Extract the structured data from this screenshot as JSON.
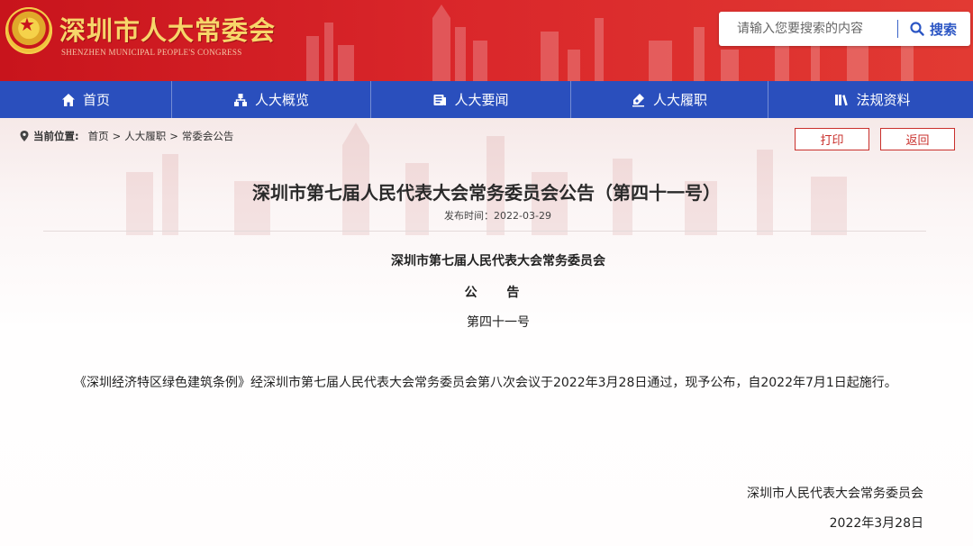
{
  "header": {
    "site_title": "深圳市人大常委会",
    "site_subtitle": "SHENZHEN MUNICIPAL PEOPLE'S CONGRESS"
  },
  "search": {
    "placeholder": "请输入您要搜索的内容",
    "button_label": "搜索"
  },
  "nav": {
    "items": [
      {
        "label": "首页",
        "icon": "home-icon"
      },
      {
        "label": "人大概览",
        "icon": "sitemap-icon"
      },
      {
        "label": "人大要闻",
        "icon": "news-icon"
      },
      {
        "label": "人大履职",
        "icon": "duty-icon"
      },
      {
        "label": "法规资料",
        "icon": "books-icon"
      }
    ]
  },
  "breadcrumb": {
    "label": "当前位置:",
    "items": [
      "首页",
      "人大履职",
      "常委会公告"
    ],
    "separator": ">"
  },
  "toolbar": {
    "print_label": "打印",
    "back_label": "返回"
  },
  "article": {
    "title": "深圳市第七届人民代表大会常务委员会公告（第四十一号）",
    "date": "发布时间：2022-03-29",
    "issuer": "深圳市第七届人民代表大会常务委员会",
    "doc_type": "公 告",
    "number": "第四十一号",
    "body": "《深圳经济特区绿色建筑条例》经深圳市第七届人民代表大会常务委员会第八次会议于2022年3月28日通过，现予公布，自2022年7月1日起施行。",
    "signature": "深圳市人民代表大会常务委员会",
    "sign_date": "2022年3月28日"
  },
  "colors": {
    "header_red": "#d9262a",
    "nav_blue": "#2a4fbd",
    "title_gold": "#f7d66a",
    "button_red": "#c9302c",
    "search_blue": "#2c56c4"
  }
}
